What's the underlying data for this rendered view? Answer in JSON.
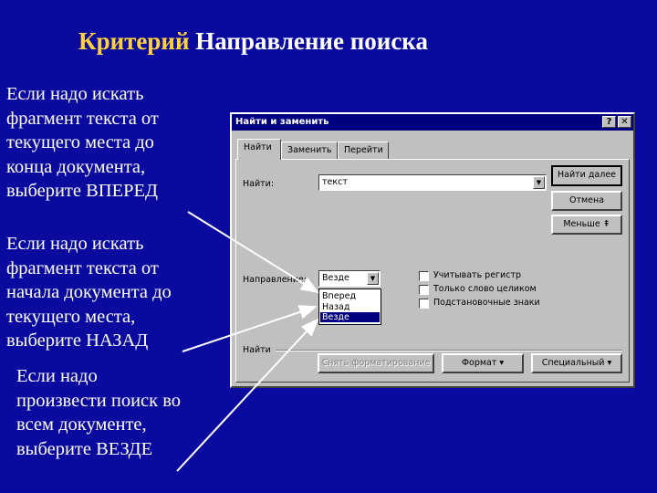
{
  "slide": {
    "title_part1": "Критерий",
    "title_part2": "Направление поиска",
    "para1": [
      "Если надо искать",
      "фрагмент текста от",
      "текущего места до",
      "конца документа,",
      "выберите ВПЕРЕД"
    ],
    "para2": [
      "Если надо искать",
      "фрагмент текста от",
      "начала документа до",
      "текущего места,",
      "выберите НАЗАД"
    ],
    "para3": [
      "Если надо",
      "произвести поиск во",
      "всем документе,",
      "выберите ВЕЗДЕ"
    ]
  },
  "dialog": {
    "title": "Найти и заменить",
    "help": "?",
    "close": "✕",
    "tabs": [
      "Найти",
      "Заменить",
      "Перейти"
    ],
    "find_label": "Найти:",
    "find_value": "текст",
    "dropdown_arrow": "▼",
    "find_next": "Найти далее",
    "cancel": "Отмена",
    "less": "Меньше ⇞",
    "direction_label": "Направление:",
    "direction_selected": "Везде",
    "direction_options": [
      "Вперед",
      "Назад",
      "Везде"
    ],
    "checkboxes": [
      "Учитывать регистр",
      "Только слово целиком",
      "Подстановочные знаки"
    ],
    "find_section": "Найти",
    "clear_format": "Снять форматирование",
    "format": "Формат ▾",
    "special": "Специальный ▾"
  },
  "colors": {
    "background": "#0a0a9e",
    "title_accent": "#ffd23a",
    "text": "#ffffff",
    "dialog": "#c0c0c0",
    "titlebar": "#000080"
  }
}
